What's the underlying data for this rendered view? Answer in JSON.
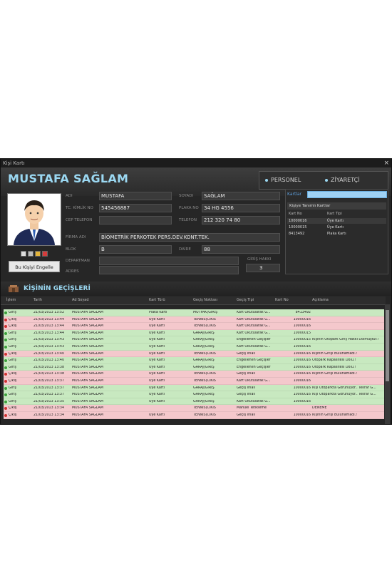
{
  "window": {
    "title": "Kişi Kartı",
    "close": "×"
  },
  "person": {
    "full_name": "MUSTAFA SAĞLAM",
    "tabs": [
      "PERSONEL",
      "ZİYARETÇİ"
    ],
    "block_button": "Bu Kişiyi Engelle",
    "fields": [
      {
        "label": "ADI",
        "value": "MUSTAFA"
      },
      {
        "label": "SOYADI",
        "value": "SAĞLAM"
      },
      {
        "label": "TC. KİMLİK NO",
        "value": "545456887"
      },
      {
        "label": "PLAKA NO",
        "value": "34 HG 4556"
      },
      {
        "label": "CEP TELEFON",
        "value": ""
      },
      {
        "label": "TELEFON",
        "value": "212 320 74 80"
      },
      {
        "label": "FİRMA ADI",
        "value": "BİOMETRİK PERKOTEK PERS.DEV.KONT.TEK."
      },
      {
        "label": "BLOK",
        "value": "B"
      },
      {
        "label": "DAİRE",
        "value": "88"
      },
      {
        "label": "DEPARTMAN",
        "value": ""
      },
      {
        "label": "GİRİŞ HAKKI",
        "value": "3"
      },
      {
        "label": "ADRES",
        "value": ""
      }
    ]
  },
  "cards": {
    "label": "Kartlar",
    "bar": "Kişiye Tanımlı Kartlar",
    "headers": [
      "Kart No",
      "Kart Tipi"
    ],
    "rows": [
      [
        "10000016",
        "Üye Kartı"
      ],
      [
        "10000015",
        "Üye Kartı"
      ],
      [
        "8413492",
        "Plaka Kartı"
      ]
    ]
  },
  "passages": {
    "title": "KİŞİNİN GEÇİŞLERİ",
    "headers": [
      "İşlem",
      "Tarih",
      "Ad Soyad",
      "Kart Türü",
      "Geçiş Noktası",
      "Geçiş Tipi",
      "Kart No",
      "Açıklama"
    ],
    "rows": [
      {
        "s": "g",
        "cells": [
          "Giriş",
          "21/03/2013 13:52",
          "MUSTAFA SAĞLAM",
          "Plaka Kartı",
          "MUTFAK(GİRİŞ",
          "Kart Okutularak G...",
          "8413492",
          ""
        ]
      },
      {
        "s": "r",
        "cells": [
          "Çıkış",
          "21/03/2013 13:44",
          "MUSTAFA SAĞLAM",
          "Üye Kartı",
          "TENNİS(CIKIS",
          "Kart Okutularak G...",
          "10000016",
          ""
        ]
      },
      {
        "s": "r",
        "cells": [
          "Çıkış",
          "21/03/2013 13:44",
          "MUSTAFA SAĞLAM",
          "Üye Kartı",
          "TENNİS(CIKIS",
          "Kart Okutularak G...",
          "10000016",
          ""
        ]
      },
      {
        "s": "g",
        "cells": [
          "Giriş",
          "21/03/2013 13:44",
          "MUSTAFA SAĞLAM",
          "Üye Kartı",
          "GARAJ(GİRİŞ",
          "Kart Okutularak G...",
          "10000015",
          ""
        ]
      },
      {
        "s": "g",
        "cells": [
          "Giriş",
          "21/03/2013 13:43",
          "MUSTAFA SAĞLAM",
          "Üye Kartı",
          "GARAJ(GİRİŞ",
          "Engellenen Geçişler",
          "10000015",
          "Kişinin Otopark Giriş Hakkı Dolmuştur.!"
        ]
      },
      {
        "s": "g",
        "cells": [
          "Giriş",
          "21/03/2013 13:43",
          "MUSTAFA SAĞLAM",
          "Üye Kartı",
          "GARAJ(GİRİŞ",
          "Kart Okutularak G...",
          "10000016",
          ""
        ]
      },
      {
        "s": "r",
        "cells": [
          "Çıkış",
          "21/03/2013 13:40",
          "MUSTAFA SAĞLAM",
          "Üye Kartı",
          "TENNİS(CIKIS",
          "Geçiş İhlali",
          "10000016",
          "Kişinin Girişi Bulunamadı.!"
        ]
      },
      {
        "s": "g",
        "cells": [
          "Giriş",
          "21/03/2013 13:40",
          "MUSTAFA SAĞLAM",
          "Üye Kartı",
          "GARAJ(GİRİŞ",
          "Engellenen Geçişler",
          "10000016",
          "Otopark Kapasitesi Dolu.!"
        ]
      },
      {
        "s": "g",
        "cells": [
          "Giriş",
          "21/03/2013 13:38",
          "MUSTAFA SAĞLAM",
          "Üye Kartı",
          "GARAJ(GİRİŞ",
          "Engellenen Geçişler",
          "10000016",
          "Otopark Kapasitesi Dolu.!"
        ]
      },
      {
        "s": "r",
        "cells": [
          "Çıkış",
          "21/03/2013 13:38",
          "MUSTAFA SAĞLAM",
          "Üye Kartı",
          "TENNİS(CIKIS",
          "Geçiş İhlali",
          "10000016",
          "Kişinin Girişi Bulunamadı.!"
        ]
      },
      {
        "s": "r",
        "cells": [
          "Çıkış",
          "21/03/2013 13:37",
          "MUSTAFA SAĞLAM",
          "Üye Kartı",
          "TENNİS(CIKIS",
          "Kart Okutularak G...",
          "10000016",
          ""
        ]
      },
      {
        "s": "g",
        "cells": [
          "Giriş",
          "21/03/2013 13:37",
          "MUSTAFA SAĞLAM",
          "Üye Kartı",
          "GARAJ(GİRİŞ",
          "Geçiş İhlali",
          "10000016",
          "Kişi Otoparkta Görünüyor.. Tekrar G..."
        ]
      },
      {
        "s": "g",
        "cells": [
          "Giriş",
          "21/03/2013 13:37",
          "MUSTAFA SAĞLAM",
          "Üye Kartı",
          "GARAJ(GİRİŞ",
          "Geçiş İhlali",
          "10000016",
          "Kişi Otoparkta Görünüyor.. Tekrar G..."
        ]
      },
      {
        "s": "g",
        "cells": [
          "Giriş",
          "21/03/2013 13:35",
          "MUSTAFA SAĞLAM",
          "Üye Kartı",
          "GARAJ(GİRİŞ",
          "Kart Okutularak G...",
          "10000016",
          ""
        ]
      },
      {
        "s": "r",
        "cells": [
          "Çıkış",
          "21/03/2013 13:34",
          "MUSTAFA SAĞLAM",
          "",
          "TENNİS(CIKIS",
          "Manuel Tetikleme",
          "",
          "DENEME"
        ]
      },
      {
        "s": "r",
        "cells": [
          "Çıkış",
          "21/03/2013 13:34",
          "MUSTAFA SAĞLAM",
          "Üye Kartı",
          "TENNİS(CIKIS",
          "Geçiş İhlali",
          "10000016",
          "Kişinin Girişi Bulunamadı.!"
        ]
      }
    ]
  },
  "colors": {
    "accent": "#9bd8f2",
    "enter_row": "#c8e9c0",
    "exit_row": "#f4c8cc",
    "enter_icon": "#3aa03a",
    "exit_icon": "#d03030"
  }
}
